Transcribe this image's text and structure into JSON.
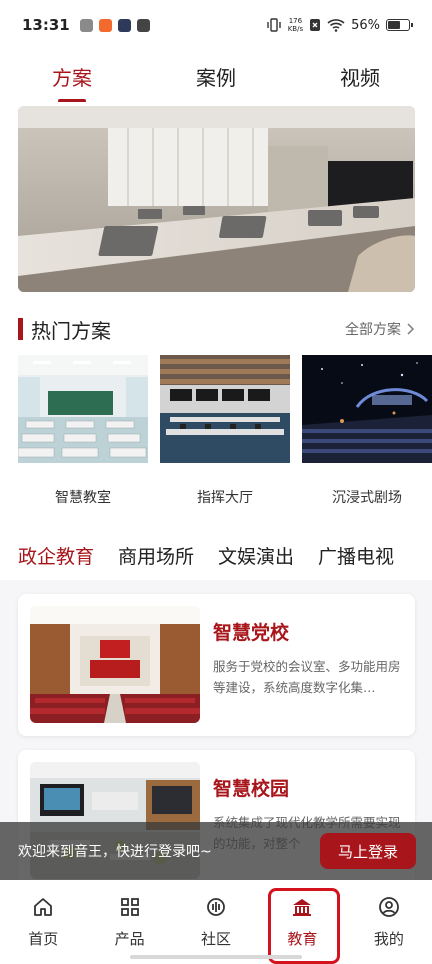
{
  "status_bar": {
    "time": "13:31",
    "net_speed_value": "176",
    "net_speed_unit": "KB/s",
    "battery_percent": "56%",
    "battery_level": 0.56
  },
  "top_tabs": [
    {
      "label": "方案",
      "active": true
    },
    {
      "label": "案例",
      "active": false
    },
    {
      "label": "视频",
      "active": false
    }
  ],
  "hot_section": {
    "title": "热门方案",
    "more_label": "全部方案",
    "items": [
      {
        "label": "智慧教室"
      },
      {
        "label": "指挥大厅"
      },
      {
        "label": "沉浸式剧场"
      }
    ]
  },
  "category_tabs": [
    {
      "label": "政企教育",
      "active": true
    },
    {
      "label": "商用场所",
      "active": false
    },
    {
      "label": "文娱演出",
      "active": false
    },
    {
      "label": "广播电视",
      "active": false
    }
  ],
  "cards": [
    {
      "title": "智慧党校",
      "desc": "服务于党校的会议室、多功能用房等建设，系统高度数字化集…"
    },
    {
      "title": "智慧校园",
      "desc": "系统集成了现代化教学所需要实现的功能，对整个"
    }
  ],
  "login_toast": {
    "text": "欢迎来到音王，快进行登录吧~",
    "button_label": "马上登录"
  },
  "bottom_nav": [
    {
      "label": "首页",
      "icon": "home-icon",
      "active": false
    },
    {
      "label": "产品",
      "icon": "grid-icon",
      "active": false
    },
    {
      "label": "社区",
      "icon": "community-icon",
      "active": false
    },
    {
      "label": "教育",
      "icon": "education-icon",
      "active": true
    },
    {
      "label": "我的",
      "icon": "profile-icon",
      "active": false
    }
  ],
  "colors": {
    "accent": "#a8161c",
    "highlight_box": "#d4131f"
  }
}
